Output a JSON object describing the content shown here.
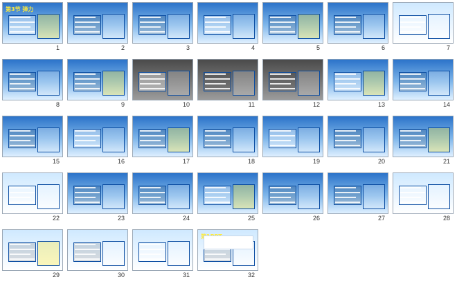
{
  "slides": [
    {
      "n": "1",
      "title": "第3节 弹力"
    },
    {
      "n": "2",
      "title": ""
    },
    {
      "n": "3",
      "title": ""
    },
    {
      "n": "4",
      "title": ""
    },
    {
      "n": "5",
      "title": ""
    },
    {
      "n": "6",
      "title": ""
    },
    {
      "n": "7",
      "title": ""
    },
    {
      "n": "8",
      "title": ""
    },
    {
      "n": "9",
      "title": ""
    },
    {
      "n": "10",
      "title": ""
    },
    {
      "n": "11",
      "title": ""
    },
    {
      "n": "12",
      "title": ""
    },
    {
      "n": "13",
      "title": ""
    },
    {
      "n": "14",
      "title": ""
    },
    {
      "n": "15",
      "title": ""
    },
    {
      "n": "16",
      "title": ""
    },
    {
      "n": "17",
      "title": ""
    },
    {
      "n": "18",
      "title": ""
    },
    {
      "n": "19",
      "title": ""
    },
    {
      "n": "20",
      "title": ""
    },
    {
      "n": "21",
      "title": ""
    },
    {
      "n": "22",
      "title": ""
    },
    {
      "n": "23",
      "title": ""
    },
    {
      "n": "24",
      "title": ""
    },
    {
      "n": "25",
      "title": ""
    },
    {
      "n": "26",
      "title": ""
    },
    {
      "n": "27",
      "title": ""
    },
    {
      "n": "28",
      "title": ""
    },
    {
      "n": "29",
      "title": ""
    },
    {
      "n": "30",
      "title": ""
    },
    {
      "n": "31",
      "title": ""
    },
    {
      "n": "32",
      "title": "第1PPT"
    }
  ]
}
